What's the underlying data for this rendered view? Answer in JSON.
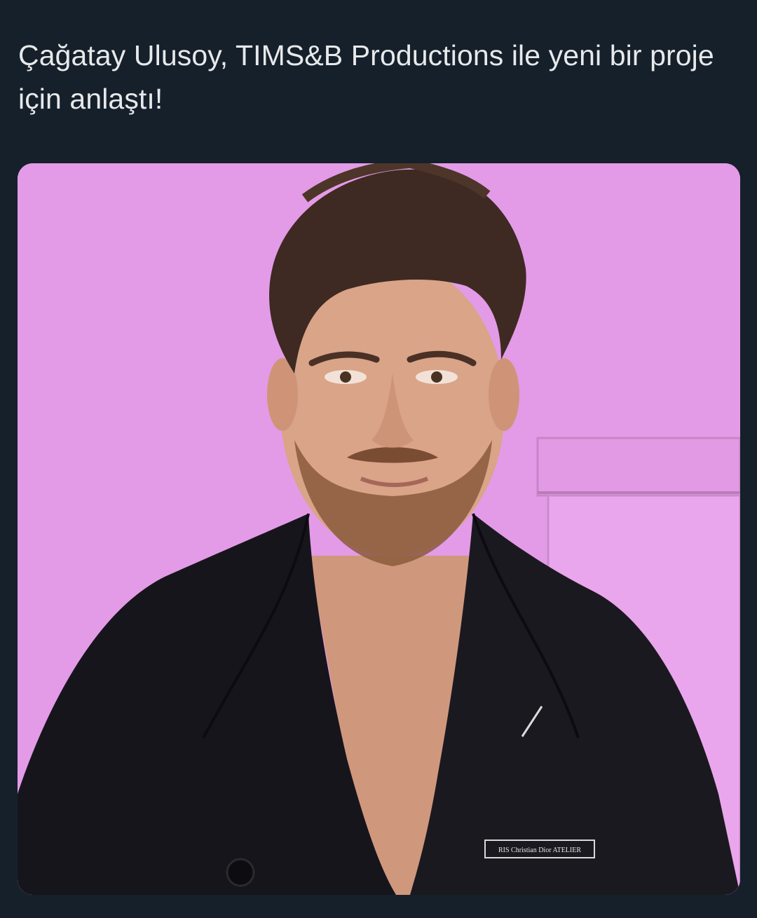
{
  "tweet": {
    "text": "Çağatay Ulusoy, TIMS&B Productions ile yeni bir proje için anlaştı!"
  },
  "media": {
    "subject": "man-in-black-blazer-portrait",
    "background_color": "#e69ee9",
    "jacket_label_text": "RIS   Christian Dior   ATELIER"
  },
  "colors": {
    "page_background": "#15202b",
    "text": "#e7e9ea",
    "wall": "#e69ee9",
    "jacket": "#17151c",
    "skin": "#d9a488",
    "hair": "#3e2a22"
  }
}
